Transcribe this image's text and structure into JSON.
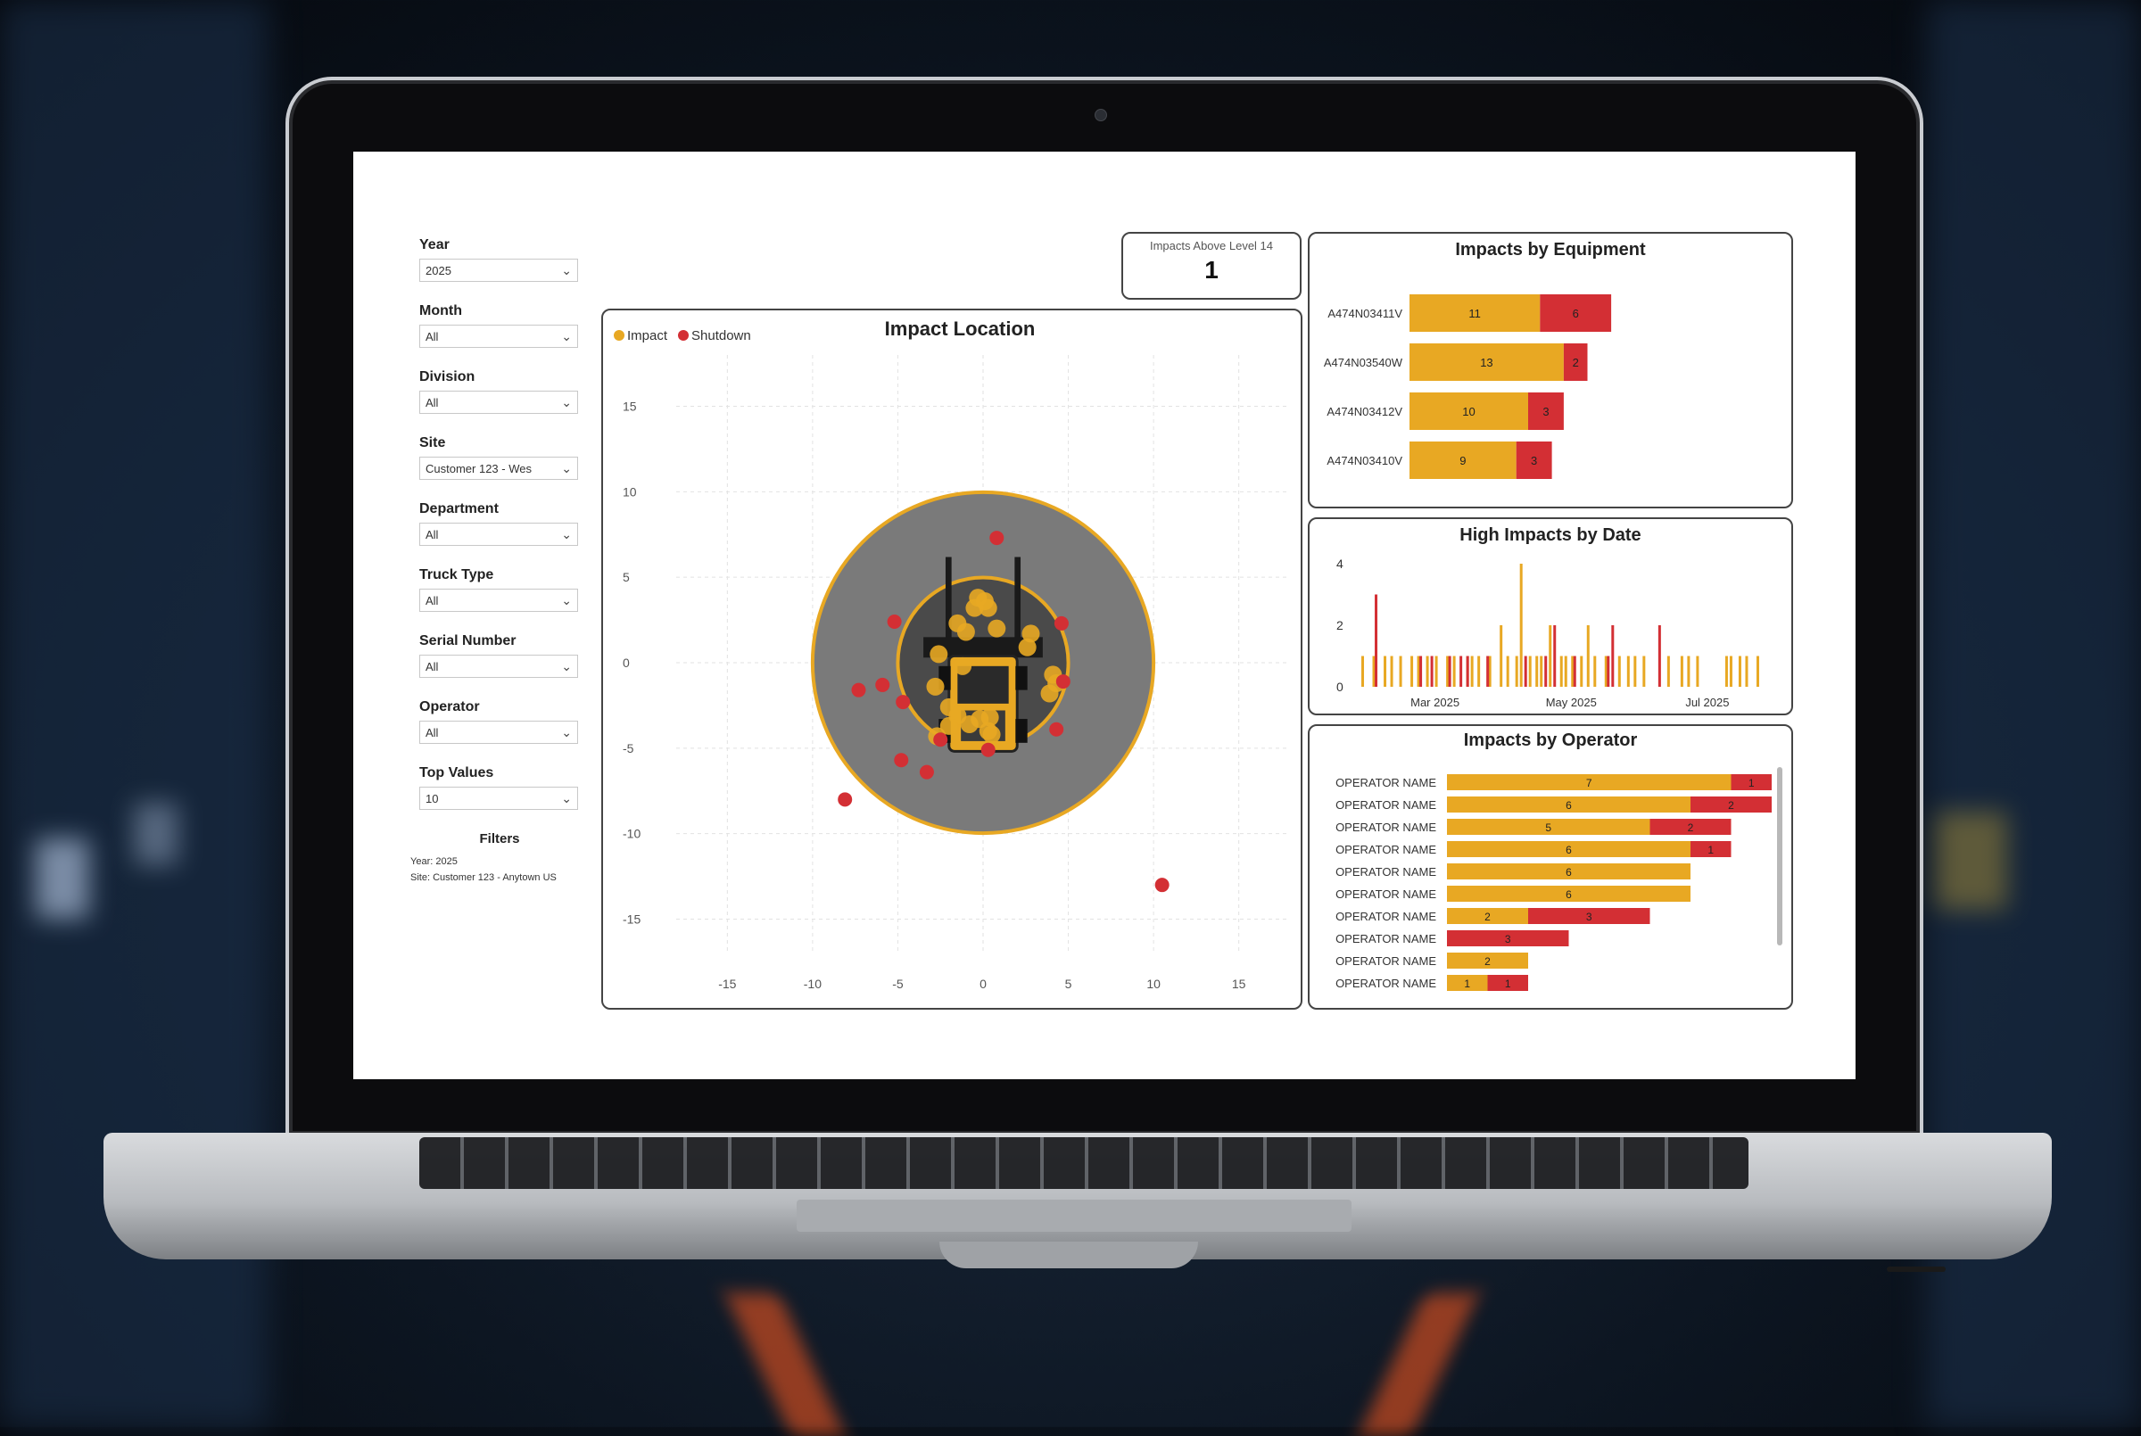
{
  "colors": {
    "impact": "#e8a823",
    "shutdown": "#d32f34",
    "zone_outer": "#7a7a7a",
    "zone_inner": "#4a4a4a",
    "ring": "#e8a823"
  },
  "slicers": [
    {
      "label": "Year",
      "value": "2025"
    },
    {
      "label": "Month",
      "value": "All"
    },
    {
      "label": "Division",
      "value": "All"
    },
    {
      "label": "Site",
      "value": "Customer 123 - Wes"
    },
    {
      "label": "Department",
      "value": "All"
    },
    {
      "label": "Truck Type",
      "value": "All"
    },
    {
      "label": "Serial Number",
      "value": "All"
    },
    {
      "label": "Operator",
      "value": "All"
    },
    {
      "label": "Top Values",
      "value": "10"
    }
  ],
  "filters": {
    "title": "Filters",
    "lines": [
      "Year: 2025",
      "Site: Customer 123 - Anytown US"
    ]
  },
  "kpi": {
    "label": "Impacts Above Level 14",
    "value": "1"
  },
  "impact_location": {
    "title": "Impact Location",
    "legend": [
      {
        "name": "Impact",
        "color": "#e8a823"
      },
      {
        "name": "Shutdown",
        "color": "#d32f34"
      }
    ],
    "chart_data": {
      "type": "scatter",
      "xlim": [
        -18,
        18
      ],
      "ylim": [
        -18,
        18
      ],
      "xticks": [
        -15,
        -10,
        -5,
        0,
        5,
        10,
        15
      ],
      "yticks": [
        15,
        10,
        5,
        0,
        -5,
        -10,
        -15
      ],
      "outer_radius": 10,
      "inner_radius": 5,
      "series": [
        {
          "name": "Impact",
          "points": [
            [
              -0.3,
              3.8
            ],
            [
              0.1,
              3.6
            ],
            [
              -0.5,
              3.2
            ],
            [
              0.3,
              3.2
            ],
            [
              -1.5,
              2.3
            ],
            [
              -1.0,
              1.8
            ],
            [
              0.8,
              2.0
            ],
            [
              2.8,
              1.7
            ],
            [
              2.6,
              0.9
            ],
            [
              -1.2,
              -0.2
            ],
            [
              -2.8,
              -1.4
            ],
            [
              -2.0,
              -2.6
            ],
            [
              -1.5,
              -3.1
            ],
            [
              -0.8,
              -3.6
            ],
            [
              -0.2,
              -3.3
            ],
            [
              0.4,
              -3.2
            ],
            [
              -2.0,
              -3.7
            ],
            [
              -2.7,
              -4.3
            ],
            [
              0.3,
              -4.0
            ],
            [
              0.5,
              -4.2
            ],
            [
              4.1,
              -0.7
            ],
            [
              4.3,
              -1.2
            ],
            [
              3.9,
              -1.8
            ],
            [
              -2.6,
              0.5
            ]
          ]
        },
        {
          "name": "Shutdown",
          "points": [
            [
              0.8,
              7.3
            ],
            [
              -5.2,
              2.4
            ],
            [
              4.6,
              2.3
            ],
            [
              -7.3,
              -1.6
            ],
            [
              -5.9,
              -1.3
            ],
            [
              -4.7,
              -2.3
            ],
            [
              4.7,
              -1.1
            ],
            [
              4.3,
              -3.9
            ],
            [
              -4.8,
              -5.7
            ],
            [
              -3.3,
              -6.4
            ],
            [
              -2.5,
              -4.5
            ],
            [
              0.3,
              -5.1
            ],
            [
              -8.1,
              -8.0
            ],
            [
              10.5,
              -13.0
            ]
          ]
        }
      ]
    }
  },
  "equipment": {
    "title": "Impacts by Equipment",
    "chart_data": {
      "type": "bar",
      "categories": [
        "A474N03411V",
        "A474N03540W",
        "A474N03412V",
        "A474N03410V"
      ],
      "series": [
        {
          "name": "Impact",
          "values": [
            11,
            13,
            10,
            9
          ]
        },
        {
          "name": "Shutdown",
          "values": [
            6,
            2,
            3,
            3
          ]
        }
      ]
    }
  },
  "high_date": {
    "title": "High Impacts by Date",
    "chart_data": {
      "type": "bar",
      "ylim": [
        0,
        4
      ],
      "yticks": [
        "4",
        "2",
        "0"
      ],
      "xticks": [
        {
          "label": "Mar 2025",
          "day": 68
        },
        {
          "label": "May 2025",
          "day": 129
        },
        {
          "label": "Jul 2025",
          "day": 190
        }
      ],
      "xlim_days": [
        31,
        222
      ],
      "series": [
        {
          "name": "Impact",
          "days": [
            35,
            40,
            45,
            48,
            52,
            57,
            60,
            64,
            68,
            73,
            76,
            82,
            84,
            87,
            92,
            97,
            100,
            104,
            106,
            110,
            113,
            115,
            119,
            124,
            126,
            129,
            133,
            136,
            139,
            144,
            150,
            154,
            157,
            161,
            172,
            178,
            181,
            185,
            198,
            200,
            204,
            207,
            212
          ],
          "values": [
            1,
            1,
            1,
            1,
            1,
            1,
            1,
            1,
            1,
            1,
            1,
            1,
            1,
            1,
            1,
            2,
            1,
            1,
            4,
            1,
            1,
            1,
            2,
            1,
            1,
            1,
            1,
            2,
            1,
            1,
            1,
            1,
            1,
            1,
            1,
            1,
            1,
            1,
            1,
            1,
            1,
            1,
            1
          ]
        },
        {
          "name": "Shutdown",
          "days": [
            41,
            61,
            66,
            74,
            79,
            82,
            91,
            108,
            117,
            121,
            130,
            145,
            147,
            168
          ],
          "values": [
            3,
            1,
            1,
            1,
            1,
            1,
            1,
            1,
            1,
            2,
            1,
            1,
            2,
            2
          ]
        }
      ]
    }
  },
  "operators": {
    "title": "Impacts by Operator",
    "chart_data": {
      "type": "bar",
      "categories": [
        "OPERATOR NAME",
        "OPERATOR NAME",
        "OPERATOR NAME",
        "OPERATOR NAME",
        "OPERATOR NAME",
        "OPERATOR NAME",
        "OPERATOR NAME",
        "OPERATOR NAME",
        "OPERATOR NAME",
        "OPERATOR NAME"
      ],
      "series": [
        {
          "name": "Impact",
          "values": [
            7,
            6,
            5,
            6,
            6,
            6,
            2,
            null,
            2,
            1
          ]
        },
        {
          "name": "Shutdown",
          "values": [
            1,
            2,
            2,
            1,
            null,
            null,
            3,
            3,
            null,
            1
          ]
        }
      ]
    }
  }
}
